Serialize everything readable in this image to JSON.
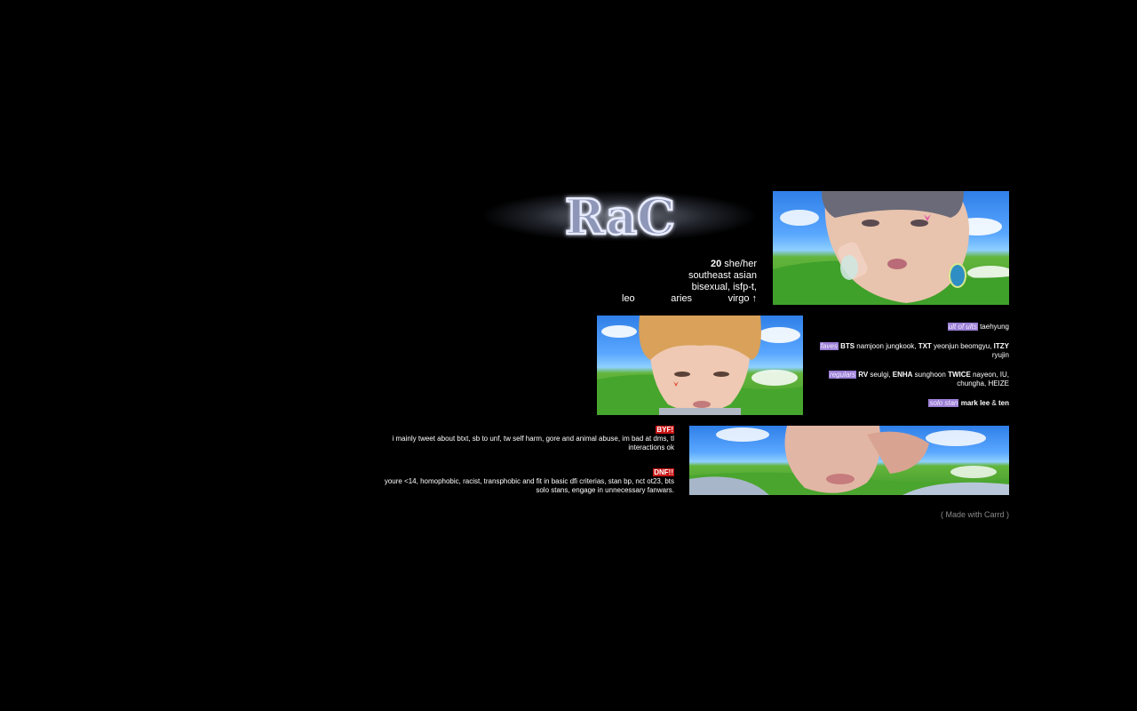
{
  "logo": {
    "text": "RaC",
    "glow_color": "#b9c6ea"
  },
  "intro": {
    "age": "20",
    "pronouns": "she/her",
    "ethnicity": "southeast asian",
    "identity": "bisexual, isfp-t,",
    "sign_1": "leo",
    "sign_2": "aries",
    "sign_3": "virgo ↑"
  },
  "faves": {
    "ult_tag": "ult of ults",
    "ult_value": "taehyung",
    "faves_tag": "faves",
    "faves_group_1": "BTS",
    "faves_members_1": "namjoon jungkook,",
    "faves_group_2": "TXT",
    "faves_members_2": "yeonjun beomgyu,",
    "faves_group_3": "ITZY",
    "faves_members_3": "ryujin",
    "regulars_tag": "regulars",
    "regulars_group_1": "RV",
    "regulars_members_1": "seulgi,",
    "regulars_group_2": "ENHA",
    "regulars_members_2": "sunghoon",
    "regulars_group_3": "TWICE",
    "regulars_members_3": "nayeon, IU, chungha, HEIZE",
    "solo_tag": "solo stan",
    "solo_1": "mark lee",
    "solo_amp": "&",
    "solo_2": "ten"
  },
  "rules": {
    "byf_tag": "BYF!",
    "byf_text": "i mainly tweet about btxt, sb to unf, tw self harm, gore and animal abuse, im bad at dms, tl interactions ok",
    "dnf_tag": "DNF!!",
    "dnf_text": "youre <14, homophobic, racist, transphobic and fit in basic dfi criterias, stan bp, nct ot23, bts solo stans, engage in unnecessary fanwars."
  },
  "footer": {
    "made_with": "( Made with Carrd )"
  },
  "colors": {
    "background": "#000000",
    "tag_purple": "#9b7fd6",
    "tag_red": "#c81414",
    "footer_text": "#8a8a8a"
  }
}
